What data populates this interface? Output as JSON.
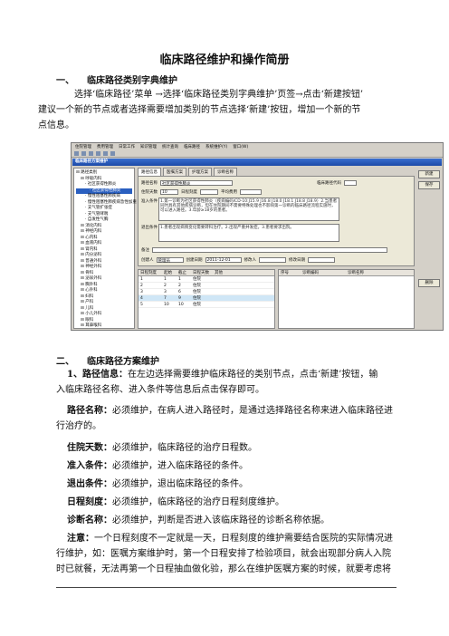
{
  "doc": {
    "title": "临床路径维护和操作简册",
    "section1": {
      "num": "一、",
      "heading": "临床路径类别字典维护"
    },
    "intro_lines": [
      "选择‘临床路径’菜单 →选择‘临床路径类别字典维护’页签→点击‘新建按钮’",
      "建议一个新的节点或者选择需要增加类别的节点选择‘新建’按钮，增加一个新的节",
      "点信息。"
    ],
    "section2": {
      "num": "二、",
      "heading": "临床路径方案维护"
    },
    "item1": {
      "label": "1、路径信息：",
      "lines": [
        "在左边选择需要维护临床路径的类别节点，点击‘新建’按钮，输",
        "入临床路径名称、进入条件等信息后点击保存即可。"
      ]
    },
    "item_name": {
      "label": "路径名称：",
      "lines": [
        "必须维护，在病人进入路径时，是通过选择路径名称来进入临床路径进",
        "行治疗的。"
      ]
    },
    "item_days": {
      "label": "住院天数：",
      "text": "必须维护，临床路径的治疗日程数。"
    },
    "item_enter": {
      "label": "准入条件：",
      "text": "必须维护，进入临床路径的条件。"
    },
    "item_exit": {
      "label": "退出条件：",
      "text": "必须维护，退出临床路径的条件。"
    },
    "item_scale": {
      "label": "日程刻度：",
      "text": "必须维护，临床路径的治疗日程刻度维护。"
    },
    "item_diag": {
      "label": "诊断名称：",
      "text": "必须维护，判断是否进入该临床路径的诊断名称依据。"
    },
    "note": {
      "label": "注意：",
      "lines": [
        "一个日程刻度不一定就是一天，日程刻度的维护需要结合医院的实际情况进",
        "行维护，如：医嘱方案维护时，第一个日程安排了检验项目，就会出现部分病人入院",
        "时已就餐，无法再第一个日程抽血做化验，那么在维护医嘱方案的时候，就要考虑将"
      ]
    }
  },
  "screenshot": {
    "menu": [
      "住院管理",
      "费用管理",
      "日常工作",
      "知识管理",
      "统计查询",
      "临床路径",
      "系统维护(Y)",
      "窗口(W)"
    ],
    "window_title": "临床路径方案维护",
    "tree": [
      {
        "label": "路径类别",
        "level": 0
      },
      {
        "label": "呼吸内科",
        "level": 1
      },
      {
        "label": "社区获得性肺炎",
        "level": 2
      },
      {
        "label": "社区获得性肺炎",
        "level": 3,
        "selected": true
      },
      {
        "label": "慢性阻塞性肺疾病",
        "level": 2
      },
      {
        "label": "慢性阻塞性肺疾病急性加重",
        "level": 2
      },
      {
        "label": "支气管扩张症",
        "level": 2
      },
      {
        "label": "支气管哮喘",
        "level": 2
      },
      {
        "label": "自发性气胸",
        "level": 2
      },
      {
        "label": "消化内科",
        "level": 1
      },
      {
        "label": "神经内科",
        "level": 1
      },
      {
        "label": "心内科",
        "level": 1
      },
      {
        "label": "血液内科",
        "level": 1
      },
      {
        "label": "肾内科",
        "level": 1
      },
      {
        "label": "内分泌科",
        "level": 1
      },
      {
        "label": "普通外科",
        "level": 1
      },
      {
        "label": "神经外科",
        "level": 1
      },
      {
        "label": "骨科",
        "level": 1
      },
      {
        "label": "泌尿外科",
        "level": 1
      },
      {
        "label": "胸外科",
        "level": 1
      },
      {
        "label": "心外科",
        "level": 1
      },
      {
        "label": "妇科",
        "level": 1
      },
      {
        "label": "产科",
        "level": 1
      },
      {
        "label": "儿科",
        "level": 1
      },
      {
        "label": "小儿外科",
        "level": 1
      },
      {
        "label": "眼科",
        "level": 1
      },
      {
        "label": "耳鼻喉科",
        "level": 1
      }
    ],
    "tabs": [
      "路径信息",
      "医嘱方案",
      "护理方案",
      "诊断名称"
    ],
    "form": {
      "path_name_label": "路径名称",
      "path_name_value": "社区获得性肺炎",
      "icd_label": "临床路径代码",
      "icd_value": "",
      "type_label": "住院天数",
      "days_value": "10",
      "scale_label": "日程刻度",
      "avg_cost_label": "平均费用",
      "enter_label": "准入条件",
      "enter_text": "1.第一诊断为社区获得性肺炎（疾病编码ICD-10:J15.9 J16.8 J18.0 J18.1 J18.8 J18.9）2.当患者同时具有其他疾病诊断，但在住院期间不需要特殊处理也不影响第一诊断的临床路径流程实施时，可以进入路径。3.年龄≥18岁的患者。",
      "exit_label": "退出条件",
      "exit_text": "1.患者出现病情变化需要转科治疗。2.出现严重并发症。3.患者要求出院。",
      "remark_label": "备注",
      "creator_label": "创建人",
      "creator_value": "管理员",
      "date_label": "创建日期",
      "date_value": "2011-12-01",
      "modifier_label": "修改人",
      "modify_date_label": "修改日期"
    },
    "grid1": {
      "headers": [
        "日程刻度",
        "起始",
        "截止",
        "日程天数",
        "其他"
      ],
      "rows": [
        [
          "1",
          "1",
          "1",
          "住院",
          ""
        ],
        [
          "2",
          "2",
          "2",
          "住院",
          ""
        ],
        [
          "3",
          "3",
          "6",
          "住院",
          ""
        ],
        [
          "4",
          "7",
          "9",
          "住院",
          ""
        ],
        [
          "5",
          "10",
          "10",
          "住院",
          ""
        ]
      ]
    },
    "grid2": {
      "headers": [
        "序号",
        "诊断编码",
        "诊断名称"
      ]
    },
    "side_buttons": [
      "新建",
      "保存",
      "删除"
    ]
  }
}
